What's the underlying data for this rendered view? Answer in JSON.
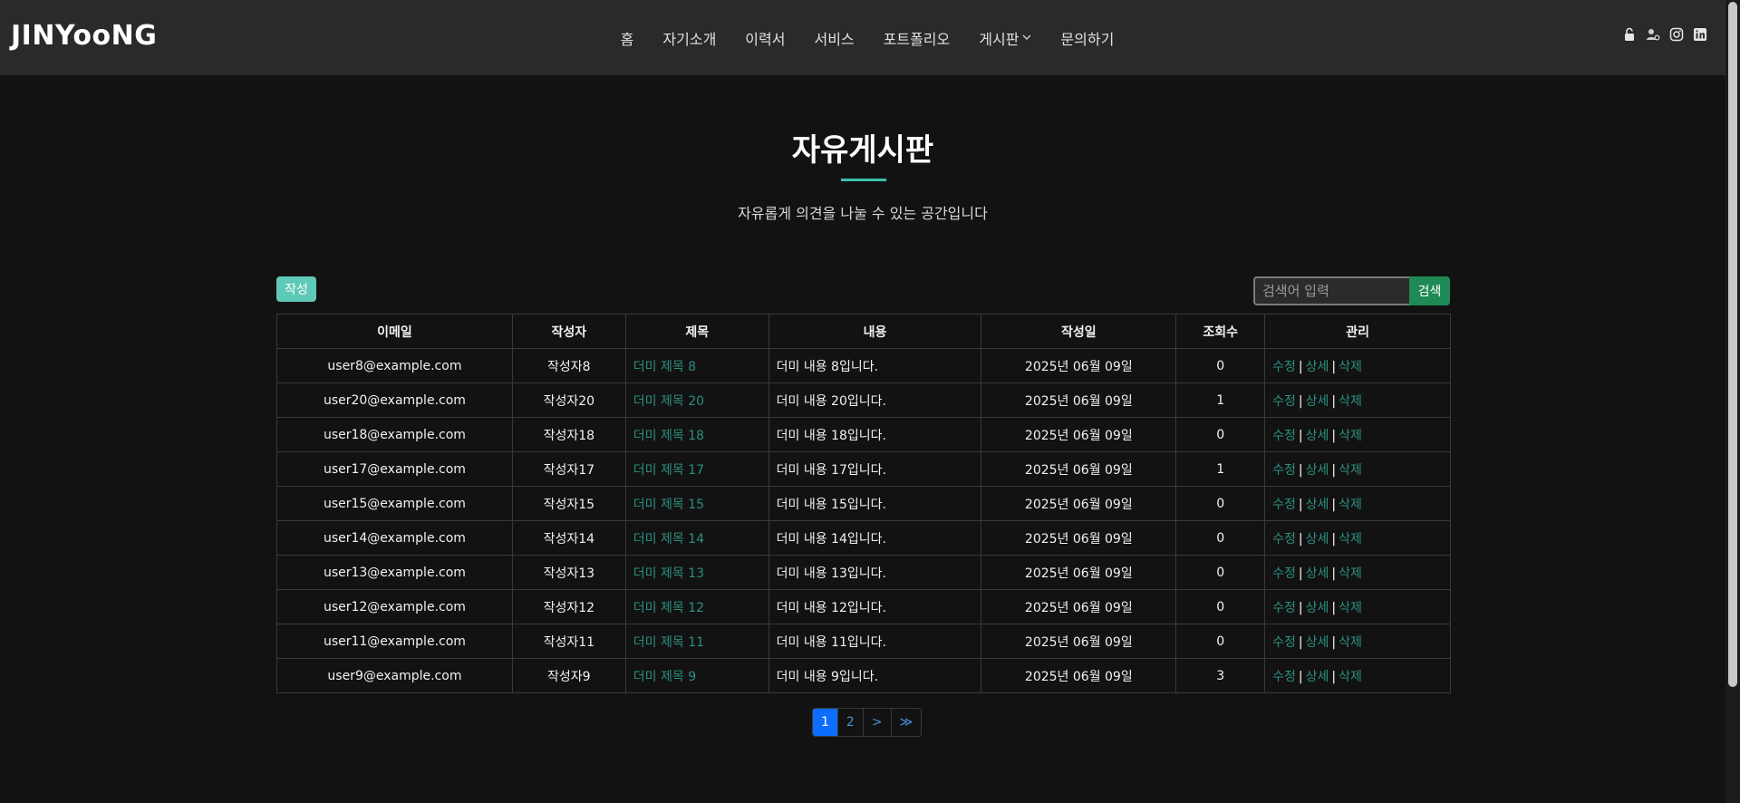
{
  "header": {
    "logo": "JINYooNG",
    "nav": [
      {
        "label": "홈"
      },
      {
        "label": "자기소개"
      },
      {
        "label": "이력서"
      },
      {
        "label": "서비스"
      },
      {
        "label": "포트폴리오"
      },
      {
        "label": "게시판",
        "dropdown": true
      },
      {
        "label": "문의하기"
      }
    ],
    "icons": [
      "unlock-icon",
      "user-gear-icon",
      "instagram-icon",
      "linkedin-icon"
    ]
  },
  "page": {
    "title": "자유게시판",
    "subtitle": "자유롭게 의견을 나눌 수 있는 공간입니다",
    "accent_color": "#3dbfa8"
  },
  "controls": {
    "write_label": "작성",
    "search_placeholder": "검색어 입력",
    "search_label": "검색"
  },
  "table": {
    "columns": [
      "이메일",
      "작성자",
      "제목",
      "내용",
      "작성일",
      "조회수",
      "관리"
    ],
    "actions": [
      "수정",
      "상세",
      "삭제"
    ],
    "rows": [
      {
        "email": "user8@example.com",
        "author": "작성자8",
        "title": "더미 제목 8",
        "content": "더미 내용 8입니다.",
        "date": "2025년 06월 09일",
        "views": "0"
      },
      {
        "email": "user20@example.com",
        "author": "작성자20",
        "title": "더미 제목 20",
        "content": "더미 내용 20입니다.",
        "date": "2025년 06월 09일",
        "views": "1"
      },
      {
        "email": "user18@example.com",
        "author": "작성자18",
        "title": "더미 제목 18",
        "content": "더미 내용 18입니다.",
        "date": "2025년 06월 09일",
        "views": "0"
      },
      {
        "email": "user17@example.com",
        "author": "작성자17",
        "title": "더미 제목 17",
        "content": "더미 내용 17입니다.",
        "date": "2025년 06월 09일",
        "views": "1"
      },
      {
        "email": "user15@example.com",
        "author": "작성자15",
        "title": "더미 제목 15",
        "content": "더미 내용 15입니다.",
        "date": "2025년 06월 09일",
        "views": "0"
      },
      {
        "email": "user14@example.com",
        "author": "작성자14",
        "title": "더미 제목 14",
        "content": "더미 내용 14입니다.",
        "date": "2025년 06월 09일",
        "views": "0"
      },
      {
        "email": "user13@example.com",
        "author": "작성자13",
        "title": "더미 제목 13",
        "content": "더미 내용 13입니다.",
        "date": "2025년 06월 09일",
        "views": "0"
      },
      {
        "email": "user12@example.com",
        "author": "작성자12",
        "title": "더미 제목 12",
        "content": "더미 내용 12입니다.",
        "date": "2025년 06월 09일",
        "views": "0"
      },
      {
        "email": "user11@example.com",
        "author": "작성자11",
        "title": "더미 제목 11",
        "content": "더미 내용 11입니다.",
        "date": "2025년 06월 09일",
        "views": "0"
      },
      {
        "email": "user9@example.com",
        "author": "작성자9",
        "title": "더미 제목 9",
        "content": "더미 내용 9입니다.",
        "date": "2025년 06월 09일",
        "views": "3"
      }
    ]
  },
  "pagination": {
    "pages": [
      "1",
      "2",
      ">",
      "≫"
    ],
    "active": "1"
  }
}
